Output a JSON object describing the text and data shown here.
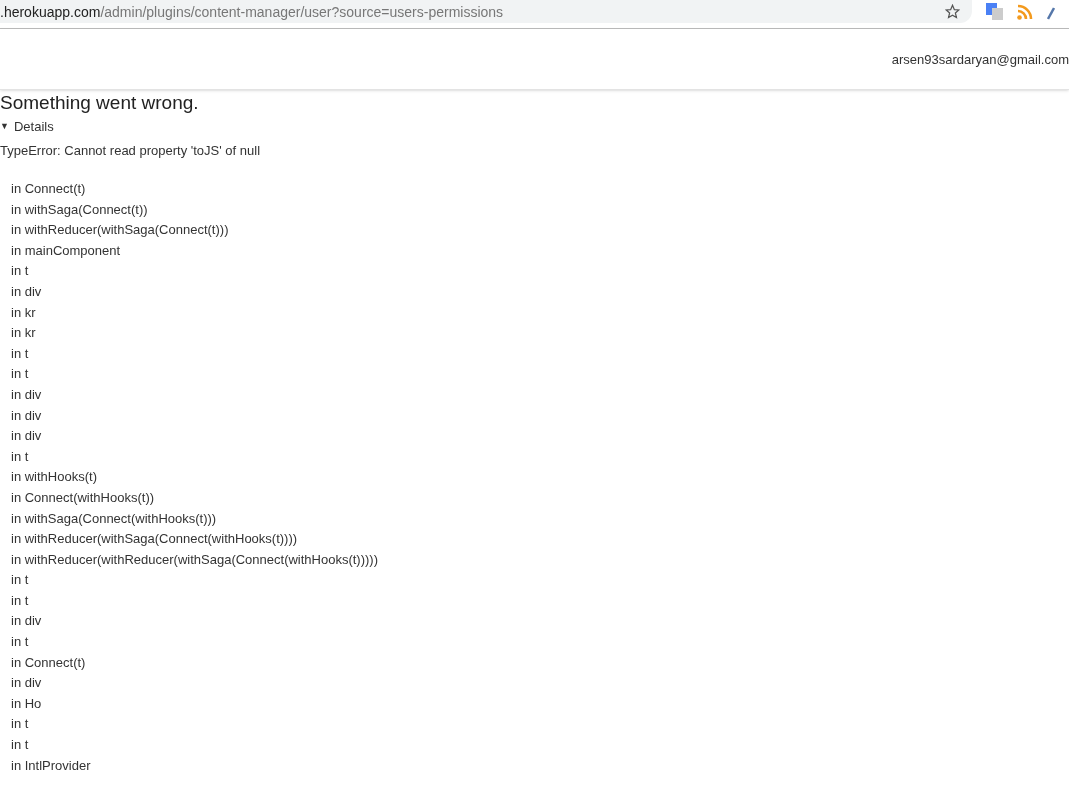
{
  "browser": {
    "url_host": ".herokuapp.com",
    "url_path": "/admin/plugins/content-manager/user?source=users-permissions"
  },
  "header": {
    "user_email": "arsen93sardaryan@gmail.com"
  },
  "error": {
    "title": "Something went wrong.",
    "details_toggle": "▼",
    "details_label": "Details",
    "message": "TypeError: Cannot read property 'toJS' of null",
    "stack": [
      "in Connect(t)",
      "in withSaga(Connect(t))",
      "in withReducer(withSaga(Connect(t)))",
      "in mainComponent",
      "in t",
      "in div",
      "in kr",
      "in kr",
      "in t",
      "in t",
      "in div",
      "in div",
      "in div",
      "in t",
      "in withHooks(t)",
      "in Connect(withHooks(t))",
      "in withSaga(Connect(withHooks(t)))",
      "in withReducer(withSaga(Connect(withHooks(t))))",
      "in withReducer(withReducer(withSaga(Connect(withHooks(t)))))",
      "in t",
      "in t",
      "in div",
      "in t",
      "in Connect(t)",
      "in div",
      "in Ho",
      "in t",
      "in t",
      "in IntlProvider"
    ]
  }
}
